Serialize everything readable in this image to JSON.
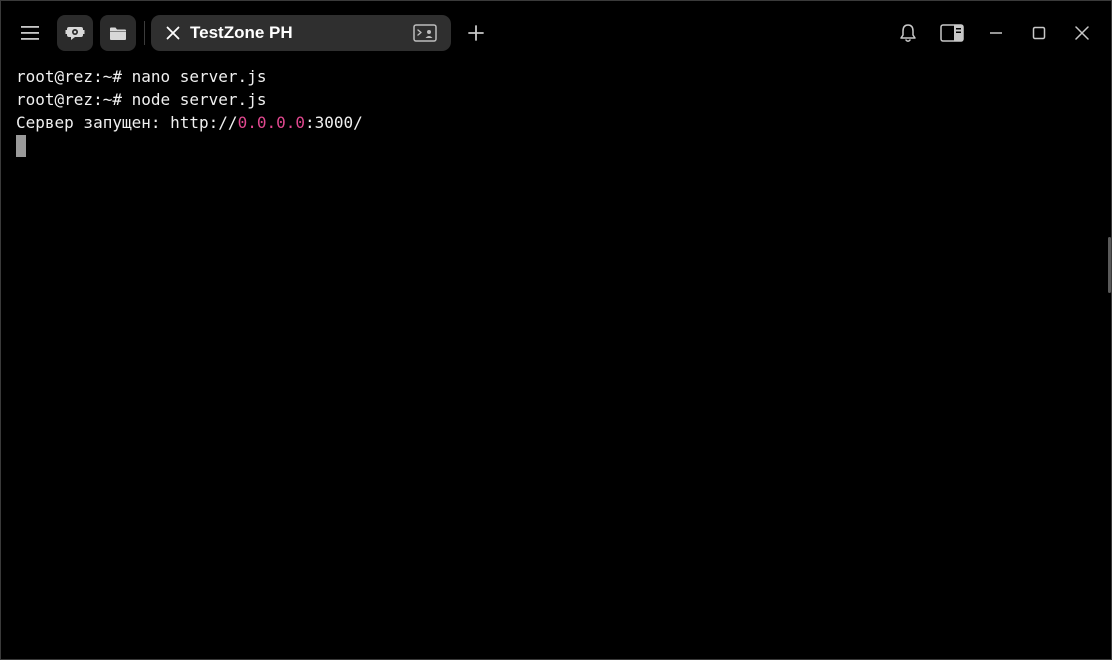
{
  "titlebar": {
    "icons": {
      "menu": "hamburger-menu-icon",
      "ai": "ai-assistant-icon",
      "folder": "folder-icon",
      "new_tab": "plus-icon",
      "bell": "bell-icon",
      "panel": "side-panel-icon",
      "minimize": "minimize-icon",
      "maximize": "maximize-icon",
      "close": "close-icon"
    }
  },
  "tab": {
    "title": "TestZone PH",
    "close_icon": "close-icon",
    "terminal_icon": "terminal-icon"
  },
  "terminal": {
    "lines": [
      "root@rez:~# nano server.js",
      "root@rez:~# node server.js"
    ],
    "output": {
      "prefix": "Сервер запущен: http://",
      "host": "0.0.0.0",
      "suffix": ":3000/"
    }
  },
  "colors": {
    "background": "#000000",
    "tab_background": "#2f2f2f",
    "text": "#f0f0f0",
    "host_highlight": "#e0488f",
    "cursor": "#9a9a9a"
  }
}
